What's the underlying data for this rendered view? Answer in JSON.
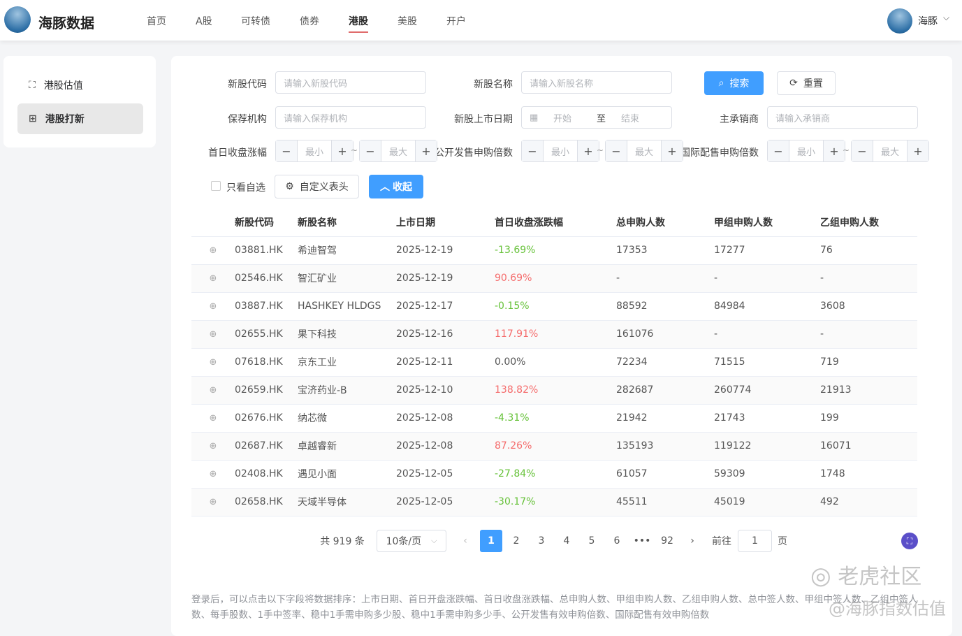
{
  "header": {
    "brand": "海豚数据",
    "nav": [
      "首页",
      "A股",
      "可转债",
      "债券",
      "港股",
      "美股",
      "开户"
    ],
    "active_nav": "港股",
    "user": "海豚"
  },
  "sidebar": {
    "items": [
      {
        "label": "港股估值",
        "icon": "presentation-icon"
      },
      {
        "label": "港股打新",
        "icon": "gift-icon",
        "active": true
      }
    ]
  },
  "filters": {
    "code_label": "新股代码",
    "code_placeholder": "请输入新股代码",
    "name_label": "新股名称",
    "name_placeholder": "请输入新股名称",
    "sponsor_label": "保荐机构",
    "sponsor_placeholder": "请输入保荐机构",
    "date_label": "新股上市日期",
    "date_start": "开始",
    "date_sep": "至",
    "date_end": "结束",
    "underwriter_label": "主承销商",
    "underwriter_placeholder": "请输入承销商",
    "close_change_label": "首日收盘涨幅",
    "public_label": "公开发售申购倍数",
    "intl_label": "国际配售申购倍数",
    "min": "最小",
    "max": "最大",
    "tilde": "~",
    "search": "搜索",
    "reset": "重置",
    "watchlist_only": "只看自选",
    "custom_header": "自定义表头",
    "collapse": "收起"
  },
  "table": {
    "columns": [
      "新股代码",
      "新股名称",
      "上市日期",
      "首日收盘涨跌幅",
      "总申购人数",
      "甲组申购人数",
      "乙组申购人数"
    ],
    "rows": [
      [
        "03881.HK",
        "希迪智驾",
        "2025-12-19",
        "-13.69%",
        "17353",
        "17277",
        "76"
      ],
      [
        "02546.HK",
        "智汇矿业",
        "2025-12-19",
        "90.69%",
        "-",
        "-",
        "-"
      ],
      [
        "03887.HK",
        "HASHKEY HLDGS",
        "2025-12-17",
        "-0.15%",
        "88592",
        "84984",
        "3608"
      ],
      [
        "02655.HK",
        "果下科技",
        "2025-12-16",
        "117.91%",
        "161076",
        "-",
        "-"
      ],
      [
        "07618.HK",
        "京东工业",
        "2025-12-11",
        "0.00%",
        "72234",
        "71515",
        "719"
      ],
      [
        "02659.HK",
        "宝济药业-B",
        "2025-12-10",
        "138.82%",
        "282687",
        "260774",
        "21913"
      ],
      [
        "02676.HK",
        "纳芯微",
        "2025-12-08",
        "-4.31%",
        "21942",
        "21743",
        "199"
      ],
      [
        "02687.HK",
        "卓越睿新",
        "2025-12-08",
        "87.26%",
        "135193",
        "119122",
        "16071"
      ],
      [
        "02408.HK",
        "遇见小面",
        "2025-12-05",
        "-27.84%",
        "61057",
        "59309",
        "1748"
      ],
      [
        "02658.HK",
        "天域半导体",
        "2025-12-05",
        "-30.17%",
        "45511",
        "45019",
        "492"
      ]
    ]
  },
  "pagination": {
    "total": "共 919 条",
    "page_size": "10条/页",
    "pages": [
      "1",
      "2",
      "3",
      "4",
      "5",
      "6",
      "•••",
      "92"
    ],
    "current": "1",
    "goto": "前往",
    "goto_value": "1",
    "page_unit": "页"
  },
  "note": "登录后，可以点击以下字段将数据排序：上市日期、首日开盘涨跌幅、首日收盘涨跌幅、总申购人数、甲组申购人数、乙组申购人数、总中签人数、甲组中签人数、乙组中签人数、每手股数、1手中签率、稳中1手需申购多少股、稳中1手需申购多少手、公开发售有效申购倍数、国际配售有效申购倍数",
  "watermark": {
    "line1": "老虎社区",
    "line2": "@海豚指数估值"
  },
  "colors": {
    "accent": "#409eff",
    "up": "#f56c6c",
    "down": "#67c23a"
  }
}
